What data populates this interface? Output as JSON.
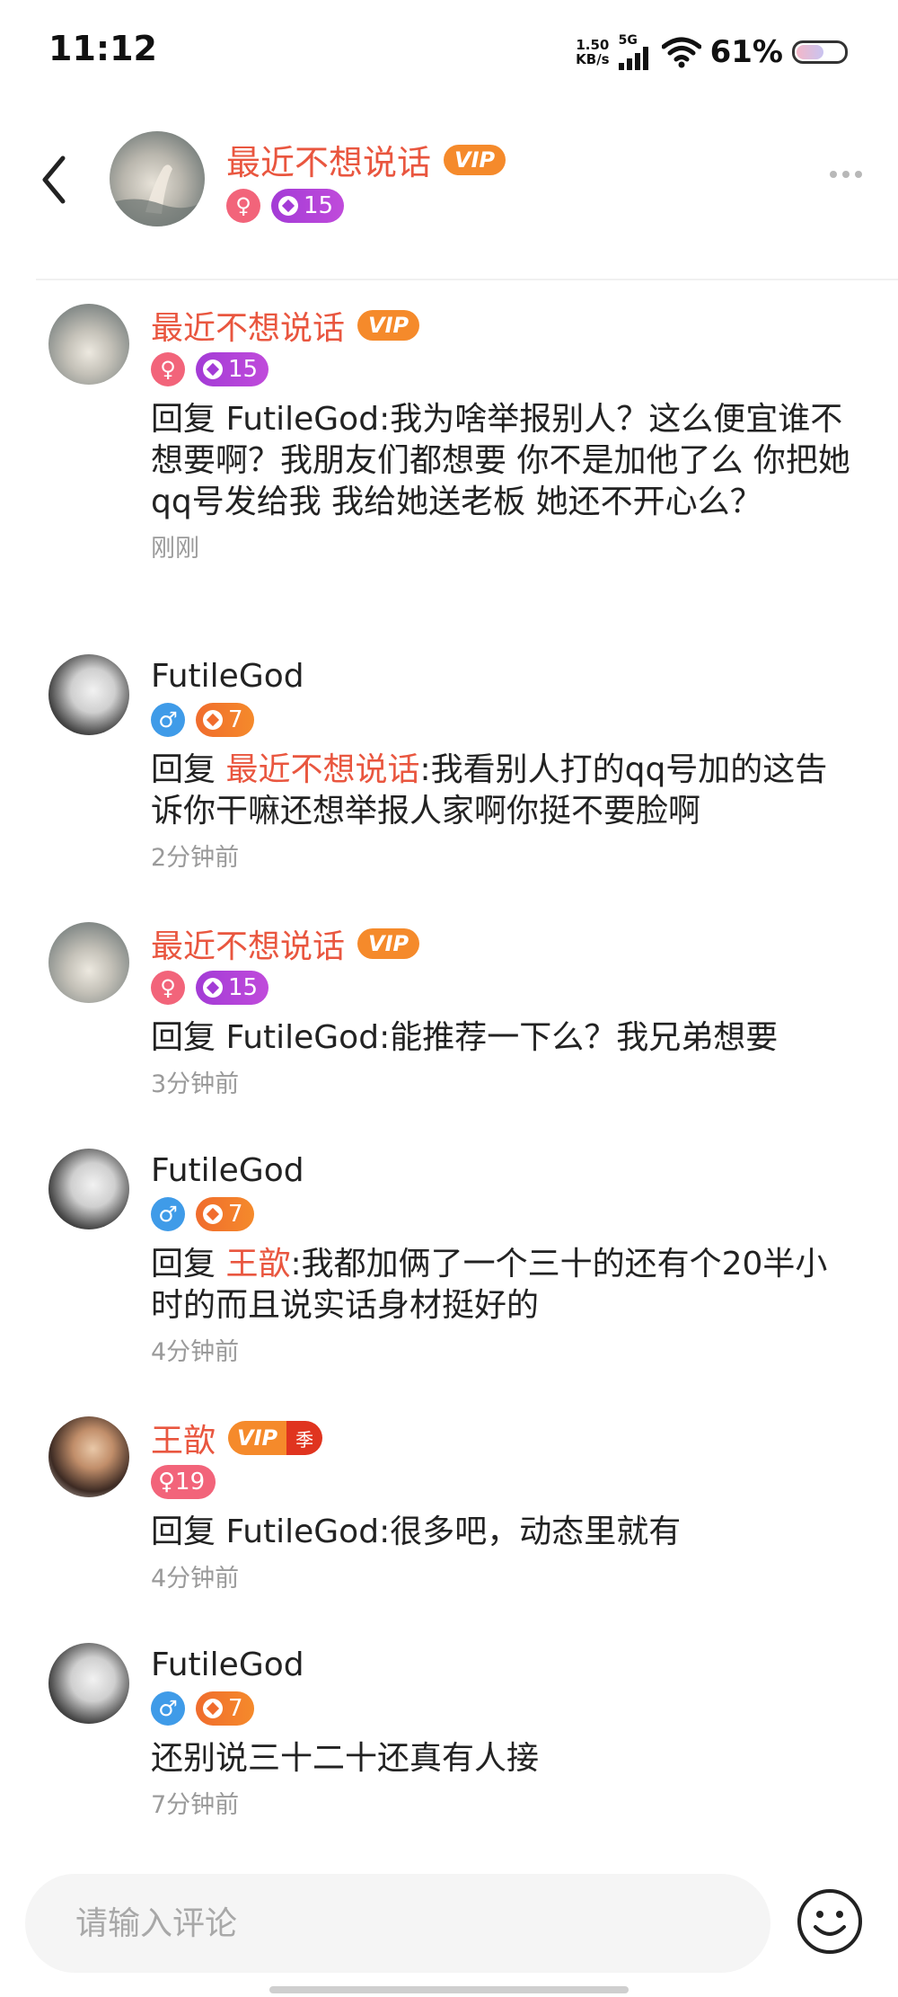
{
  "status_bar": {
    "time": "11:12",
    "net_speed_value": "1.50",
    "net_speed_unit": "KB/s",
    "network_type": "5G",
    "battery_percent_text": "61%",
    "battery_level": 0.61
  },
  "header": {
    "name": "最近不想说话",
    "vip_label": "VIP",
    "level": "15",
    "icons": [
      "back-icon",
      "more-icon"
    ]
  },
  "comments": [
    {
      "author": "最近不想说话",
      "author_color": "#e9563f",
      "vip_label": "VIP",
      "level": "15",
      "reply_prefix": "回复 ",
      "reply_target": "FutileGod",
      "text": ":我为啥举报别人？这么便宜谁不想要啊？我朋友们都想要 你不是加他了么 你把她qq号发给我 我给她送老板 她还不开心么？",
      "time": "刚刚"
    },
    {
      "author": "FutileGod",
      "level": "7",
      "reply_prefix": "回复 ",
      "reply_target": "最近不想说话",
      "text": ":我看别人打的qq号加的这告诉你干嘛还想举报人家啊你挺不要脸啊",
      "time": "2分钟前"
    },
    {
      "author": "最近不想说话",
      "vip_label": "VIP",
      "level": "15",
      "reply_prefix": "回复 ",
      "reply_target": "FutileGod",
      "text": ":能推荐一下么？我兄弟想要",
      "time": "3分钟前"
    },
    {
      "author": "FutileGod",
      "level": "7",
      "reply_prefix": "回复 ",
      "reply_target": "王歆",
      "text": ":我都加俩了一个三十的还有个20半小时的而且说实话身材挺好的",
      "time": "4分钟前"
    },
    {
      "author": "王歆",
      "vip_label": "VIP",
      "vip_season": "季",
      "level_badge": "♀19",
      "reply_prefix": "回复 ",
      "reply_target": "FutileGod",
      "text": ":很多吧，动态里就有",
      "time": "4分钟前"
    },
    {
      "author": "FutileGod",
      "level": "7",
      "text": "还别说三十二十还真有人接",
      "time": "7分钟前"
    }
  ],
  "input": {
    "placeholder": "请输入评论",
    "value": ""
  },
  "colors": {
    "accent_red": "#e9563f",
    "vip_orange": "#f58a2b",
    "female_pink": "#f2647a",
    "male_blue": "#3f9be8",
    "level_purple": "#a33bd6"
  }
}
